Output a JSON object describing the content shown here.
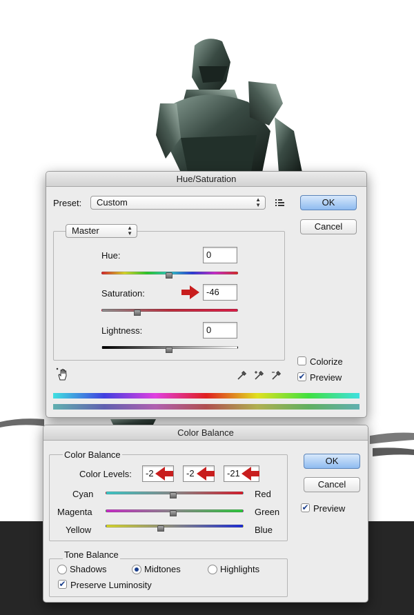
{
  "colors": {
    "accent": "#8fbbf0",
    "arrow": "#c81e1e",
    "dialog_bg": "#ececec",
    "backdrop_dark": "#262626"
  },
  "hue_saturation": {
    "title": "Hue/Saturation",
    "preset_label": "Preset:",
    "preset_value": "Custom",
    "preset_menu_icon": "list-menu-icon",
    "ok_label": "OK",
    "cancel_label": "Cancel",
    "channel_value": "Master",
    "hue_label": "Hue:",
    "hue_value": "0",
    "saturation_label": "Saturation:",
    "saturation_value": "-46",
    "lightness_label": "Lightness:",
    "lightness_value": "0",
    "colorize_label": "Colorize",
    "colorize_checked": false,
    "preview_label": "Preview",
    "preview_checked": true,
    "hand_icon": "targeted-adjustment-hand-icon",
    "eyedropper_icons": [
      "eyedropper-icon",
      "eyedropper-plus-icon",
      "eyedropper-minus-icon"
    ]
  },
  "color_balance": {
    "title": "Color Balance",
    "group_label": "Color Balance",
    "levels_label": "Color Levels:",
    "levels": [
      "-2",
      "-2",
      "-21"
    ],
    "slider_left": [
      "Cyan",
      "Magenta",
      "Yellow"
    ],
    "slider_right": [
      "Red",
      "Green",
      "Blue"
    ],
    "ok_label": "OK",
    "cancel_label": "Cancel",
    "preview_label": "Preview",
    "preview_checked": true,
    "tone_group_label": "Tone Balance",
    "tone_options": [
      "Shadows",
      "Midtones",
      "Highlights"
    ],
    "tone_selected": "Midtones",
    "preserve_label": "Preserve Luminosity",
    "preserve_checked": true
  }
}
